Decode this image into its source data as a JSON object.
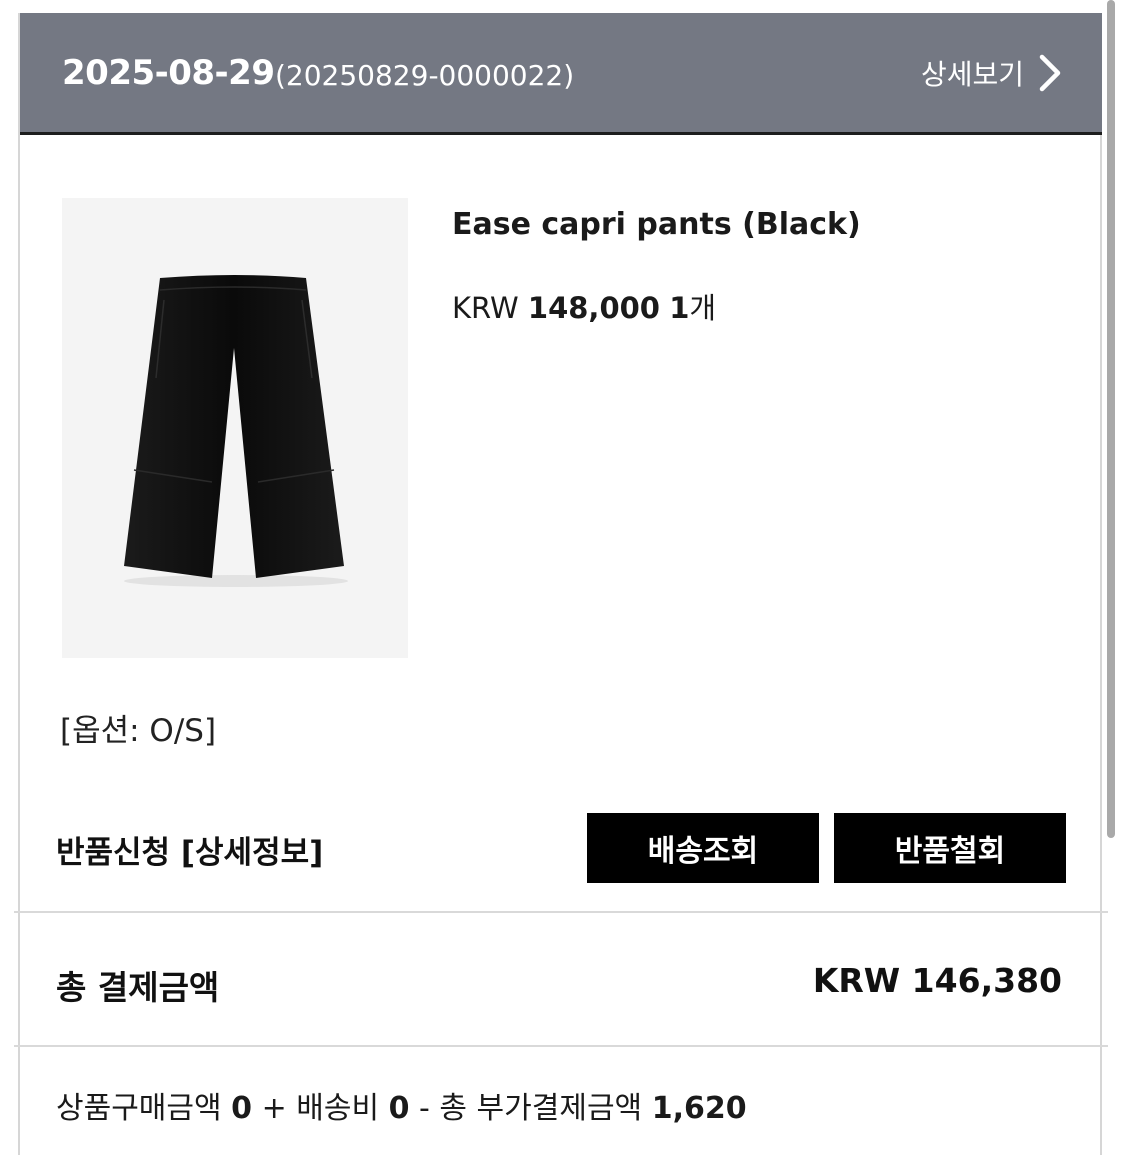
{
  "order": {
    "date": "2025-08-29",
    "number": "(20250829-0000022)",
    "detail_link": "상세보기"
  },
  "product": {
    "name": "Ease capri pants (Black)",
    "currency": "KRW",
    "price": "148,000",
    "quantity": "1",
    "quantity_unit": "개",
    "option": "[옵션: O/S]",
    "image_icon": "black-capri-pants-image"
  },
  "status": {
    "label": "반품신청 [상세정보]"
  },
  "buttons": {
    "track_delivery": "배송조회",
    "cancel_return": "반품철회"
  },
  "payment": {
    "total_label": "총 결제금액",
    "total_value": "KRW 146,380",
    "breakdown": {
      "product_label": "상품구매금액",
      "product_amount": "0",
      "plus": "+",
      "shipping_label": "배송비",
      "shipping_amount": "0",
      "minus": "-",
      "extra_label": "총 부가결제금액",
      "extra_amount": "1,620"
    }
  },
  "colors": {
    "header_bg": "#747883",
    "button_bg": "#000000",
    "thumb_bg": "#f4f4f4"
  }
}
